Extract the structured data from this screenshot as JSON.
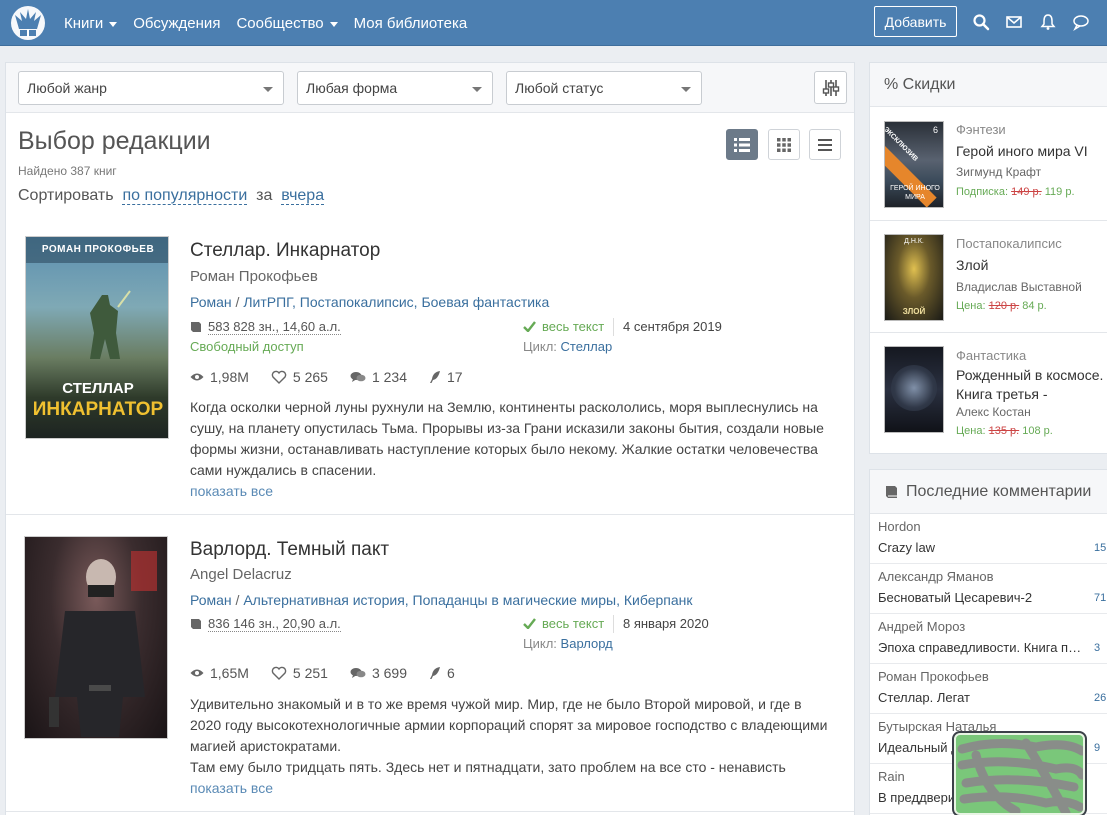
{
  "nav": {
    "items": [
      {
        "label": "Книги",
        "dropdown": true
      },
      {
        "label": "Обсуждения",
        "dropdown": false
      },
      {
        "label": "Сообщество",
        "dropdown": true
      },
      {
        "label": "Моя библиотека",
        "dropdown": false
      }
    ],
    "add_label": "Добавить",
    "icons": [
      "search-icon",
      "mail-icon",
      "bell-icon",
      "chat-icon"
    ],
    "bar_color": "#4c7fb1"
  },
  "filters": {
    "genre": "Любой жанр",
    "form": "Любая форма",
    "status": "Любой статус"
  },
  "page": {
    "title": "Выбор редакции",
    "found": "Найдено 387 книг",
    "sort_prefix": "Сортировать",
    "sort_by": "по популярности",
    "sort_mid": "за",
    "sort_period": "вчера"
  },
  "books": [
    {
      "title": "Стеллар. Инкарнатор",
      "author": "Роман Прокофьев",
      "genre_main": "Роман",
      "genre_sep": " / ",
      "genres": "ЛитРПГ, Постапокалипсис, Боевая фантастика",
      "size_chars": "583 828 зн.",
      "size_sheets": "14,60 а.л.",
      "access": "Свободный доступ",
      "status": "весь текст",
      "date": "4 сентября 2019",
      "cycle_label": "Цикл:",
      "cycle": "Стеллар",
      "views": "1,98M",
      "likes": "5 265",
      "comments": "1 234",
      "rewards": "17",
      "description": "Когда осколки черной луны рухнули на Землю, континенты раскололись, моря выплеснулись на сушу, на планету опустилась Тьма. Прорывы из-за Грани исказили законы бытия, создали новые формы жизни, останавливать наступление которых было некому. Жалкие остатки человечества сами нуждались в спасении.",
      "more": "показать все",
      "cover_author": "РОМАН ПРОКОФЬЕВ",
      "cover_title1": "СТЕЛЛАР",
      "cover_title2": "ИНКАРНАТОР"
    },
    {
      "title": "Варлорд. Темный пакт",
      "author": "Angel Delacruz",
      "genre_main": "Роман",
      "genre_sep": " / ",
      "genres": "Альтернативная история, Попаданцы в магические миры, Киберпанк",
      "size_chars": "836 146 зн.",
      "size_sheets": "20,90 а.л.",
      "status": "весь текст",
      "date": "8 января 2020",
      "cycle_label": "Цикл:",
      "cycle": "Варлорд",
      "views": "1,65M",
      "likes": "5 251",
      "comments": "3 699",
      "rewards": "6",
      "description": "Удивительно знакомый и в то же время чужой мир. Мир, где не было Второй мировой, и где в 2020 году высокотехнологичные армии корпораций спорят за мировое господство с владеющими магией аристократами.",
      "description2": "Там ему было тридцать пять. Здесь нет и пятнадцати, зато проблем на все сто - ненависть",
      "more": "показать все"
    }
  ],
  "deals": {
    "heading": "% Скидки",
    "items": [
      {
        "genre": "Фэнтези",
        "title": "Герой иного мира VI",
        "author": "Зигмунд Крафт",
        "price_label": "Подписка:",
        "old_price": "149 р.",
        "new_price": "119 р.",
        "badge": "ЭКСКЛЮЗИВ",
        "cover_num": "6",
        "cover_text": "ГЕРОЙ ИНОГО МИРА"
      },
      {
        "genre": "Постапокалипсис",
        "title": "Злой",
        "author": "Владислав Выставной",
        "price_label": "Цена:",
        "old_price": "120 р.",
        "new_price": "84 р.",
        "cover_text": "ЗЛОЙ",
        "cover_top": "Д.Н.К."
      },
      {
        "genre": "Фантастика",
        "title": "Рожденный в космосе. Книга третья - Второе…",
        "author": "Алекс Костан",
        "price_label": "Цена:",
        "old_price": "135 р.",
        "new_price": "108 р."
      }
    ]
  },
  "comments": {
    "heading": "Последние комментарии",
    "items": [
      {
        "user": "Hordon",
        "book": "Crazy law",
        "count": "15"
      },
      {
        "user": "Александр Яманов",
        "book": "Бесноватый Цесаревич-2",
        "count": "71"
      },
      {
        "user": "Андрей Мороз",
        "book": "Эпоха справедливости. Книга п…",
        "count": "3"
      },
      {
        "user": "Роман Прокофьев",
        "book": "Стеллар. Легат",
        "count": "26"
      },
      {
        "user": "Бутырская Наталья",
        "book": "Идеальный д…",
        "count": "9"
      },
      {
        "user": "Rain",
        "book": "В преддвери…",
        "count": ""
      }
    ]
  }
}
